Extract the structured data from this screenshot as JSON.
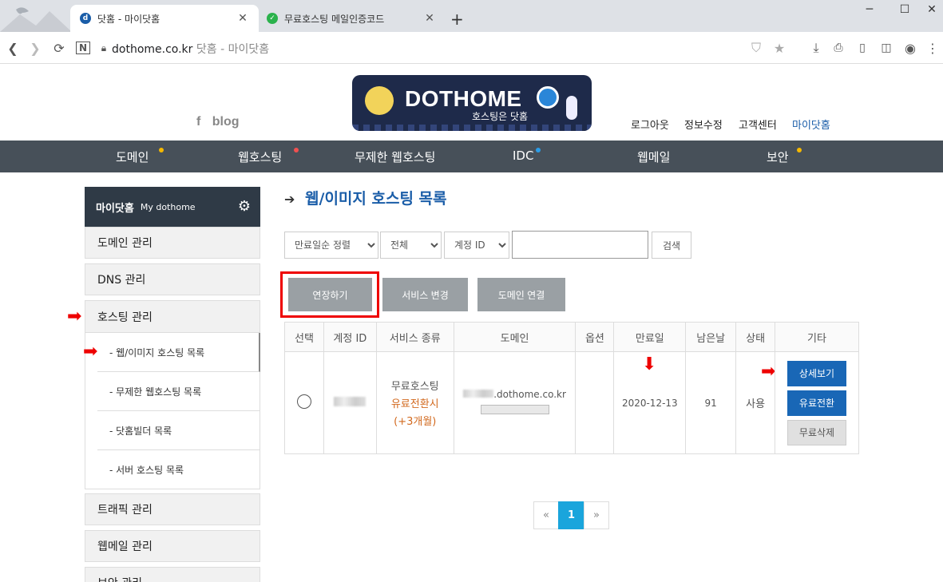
{
  "browser": {
    "tabs": [
      {
        "title": "닷홈 - 마이닷홈",
        "close": "✕"
      },
      {
        "title": "무료호스팅 메일인증코드",
        "close": "✕"
      }
    ],
    "new_tab": "+",
    "window_controls": [
      "─",
      "☐",
      "✕"
    ],
    "url_domain": "dothome.co.kr",
    "url_title": "닷홈 - 마이닷홈"
  },
  "header": {
    "logo_text": "DOTHOME",
    "logo_slogan": "호스팅은 닷홈",
    "social": {
      "facebook": "f",
      "blog": "blog"
    },
    "top_menu": [
      "로그아웃",
      "정보수정",
      "고객센터",
      "마이닷홈"
    ]
  },
  "gnb": {
    "items": [
      "도메인",
      "웹호스팅",
      "무제한 웹호스팅",
      "IDC",
      "웹메일",
      "보안"
    ]
  },
  "sidebar": {
    "head_title": "마이닷홈",
    "head_sub": "My dothome",
    "domain": "도메인 관리",
    "dns": "DNS 관리",
    "hosting": "호스팅 관리",
    "sub": [
      "- 웹/이미지 호스팅 목록",
      "- 무제한 웹호스팅 목록",
      "- 닷홈빌더 목록",
      "- 서버 호스팅 목록"
    ],
    "traffic": "트래픽 관리",
    "webmail": "웹메일 관리",
    "security": "보안 관리"
  },
  "main": {
    "title": "웹/이미지 호스팅 목록",
    "filters": {
      "sort": "만료일순 정렬",
      "scope": "전체",
      "field": "계정 ID",
      "search_value": "",
      "search_button": "검색"
    },
    "buttons": {
      "renew": "연장하기",
      "change": "서비스 변경",
      "connect": "도메인 연결"
    },
    "table": {
      "headers": [
        "선택",
        "계정 ID",
        "서비스 종류",
        "도메인",
        "옵션",
        "만료일",
        "남은날",
        "상태",
        "기타"
      ],
      "row": {
        "service": "무료호스팅",
        "service_note": "유료전환시",
        "service_note2": "(+3개월)",
        "domain": ".dothome.co.kr",
        "option": "",
        "expire": "2020-12-13",
        "days_left": "91",
        "status": "사용",
        "btn_detail": "상세보기",
        "btn_paid": "유료전환",
        "btn_delete": "무료삭제"
      }
    },
    "pagination": {
      "prev": "«",
      "current": "1",
      "next": "»"
    }
  },
  "colors": {
    "gnb_bg": "#475059",
    "title_blue": "#1a5da8",
    "action_blue": "#1967b6",
    "highlight_red": "#e00000",
    "pager_active": "#1aa5dc"
  }
}
